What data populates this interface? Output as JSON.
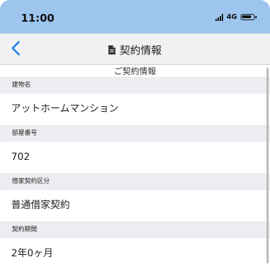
{
  "status_bar": {
    "time": "11:00",
    "network": "4G"
  },
  "nav": {
    "title": "契約情報",
    "back_icon": "chevron-left-icon",
    "title_icon": "document-icon"
  },
  "section": {
    "header": "ご契約情報"
  },
  "fields": [
    {
      "label": "建物名",
      "value": "アットホームマンション"
    },
    {
      "label": "部屋番号",
      "value": "702"
    },
    {
      "label": "借家契約区分",
      "value": "普通借家契約"
    },
    {
      "label": "契約期間",
      "value": "2年0ヶ月"
    }
  ],
  "colors": {
    "status_bar": "#9dc5ee",
    "nav_bar": "#f1f1f4",
    "label_row": "#ededf1",
    "accent": "#1a7cf0"
  }
}
